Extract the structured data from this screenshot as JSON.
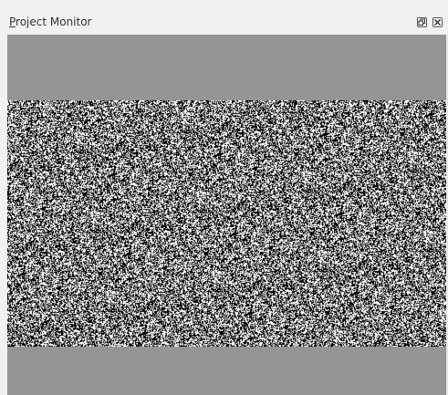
{
  "window": {
    "title_mnemonic": "P",
    "title_rest": "roject Monitor",
    "buttons": [
      "float-icon",
      "close-icon"
    ]
  },
  "monitor": {
    "letterbox_color": "#959595",
    "content": "static-noise"
  }
}
